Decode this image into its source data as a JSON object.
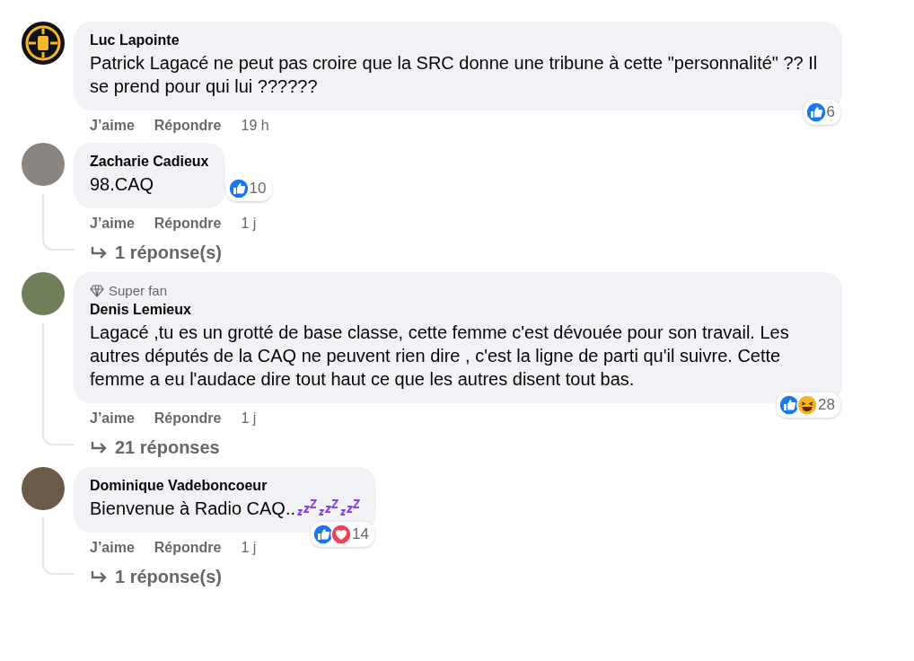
{
  "comments": [
    {
      "avatar": {
        "kind": "logo"
      },
      "author": "Luc Lapointe",
      "text": "Patrick Lagacé ne peut pas croire que la SRC donne une tribune à cette \"personnalité\" ?? Il se prend pour qui lui ??????",
      "reactions": [
        {
          "kind": "like"
        }
      ],
      "reaction_count": "6",
      "actions": [
        "J’aime",
        "Répondre"
      ],
      "time": "19 h"
    },
    {
      "avatar": {
        "kind": "photo"
      },
      "author": "Zacharie Cadieux",
      "text": "98.CAQ",
      "reactions": [
        {
          "kind": "like"
        }
      ],
      "reaction_count": "10",
      "actions": [
        "J’aime",
        "Répondre"
      ],
      "time": "1 j",
      "replies_link": "1 réponse(s)"
    },
    {
      "avatar": {
        "kind": "photo"
      },
      "badge": "Super fan",
      "author": "Denis Lemieux",
      "text": "Lagacé ,tu es un grotté de base classe, cette femme c'est dévouée pour son travail. Les autres députés de la CAQ ne peuvent rien dire , c'est la ligne de parti qu'il suivre. Cette femme a eu l'audace dire tout haut ce que les autres disent tout bas.",
      "reactions": [
        {
          "kind": "like"
        },
        {
          "kind": "haha"
        }
      ],
      "reaction_count": "28",
      "actions": [
        "J’aime",
        "Répondre"
      ],
      "time": "1 j",
      "replies_link": "21 réponses"
    },
    {
      "avatar": {
        "kind": "photo"
      },
      "author": "Dominique Vadeboncoeur",
      "text": "Bienvenue à Radio CAQ..",
      "emojis": [
        {
          "kind": "sleeping"
        },
        {
          "kind": "sleeping"
        },
        {
          "kind": "sleeping"
        }
      ],
      "reactions": [
        {
          "kind": "like"
        },
        {
          "kind": "love"
        }
      ],
      "reaction_count": "14",
      "actions": [
        "J’aime",
        "Répondre"
      ],
      "time": "1 j",
      "replies_link": "1 réponse(s)"
    }
  ]
}
